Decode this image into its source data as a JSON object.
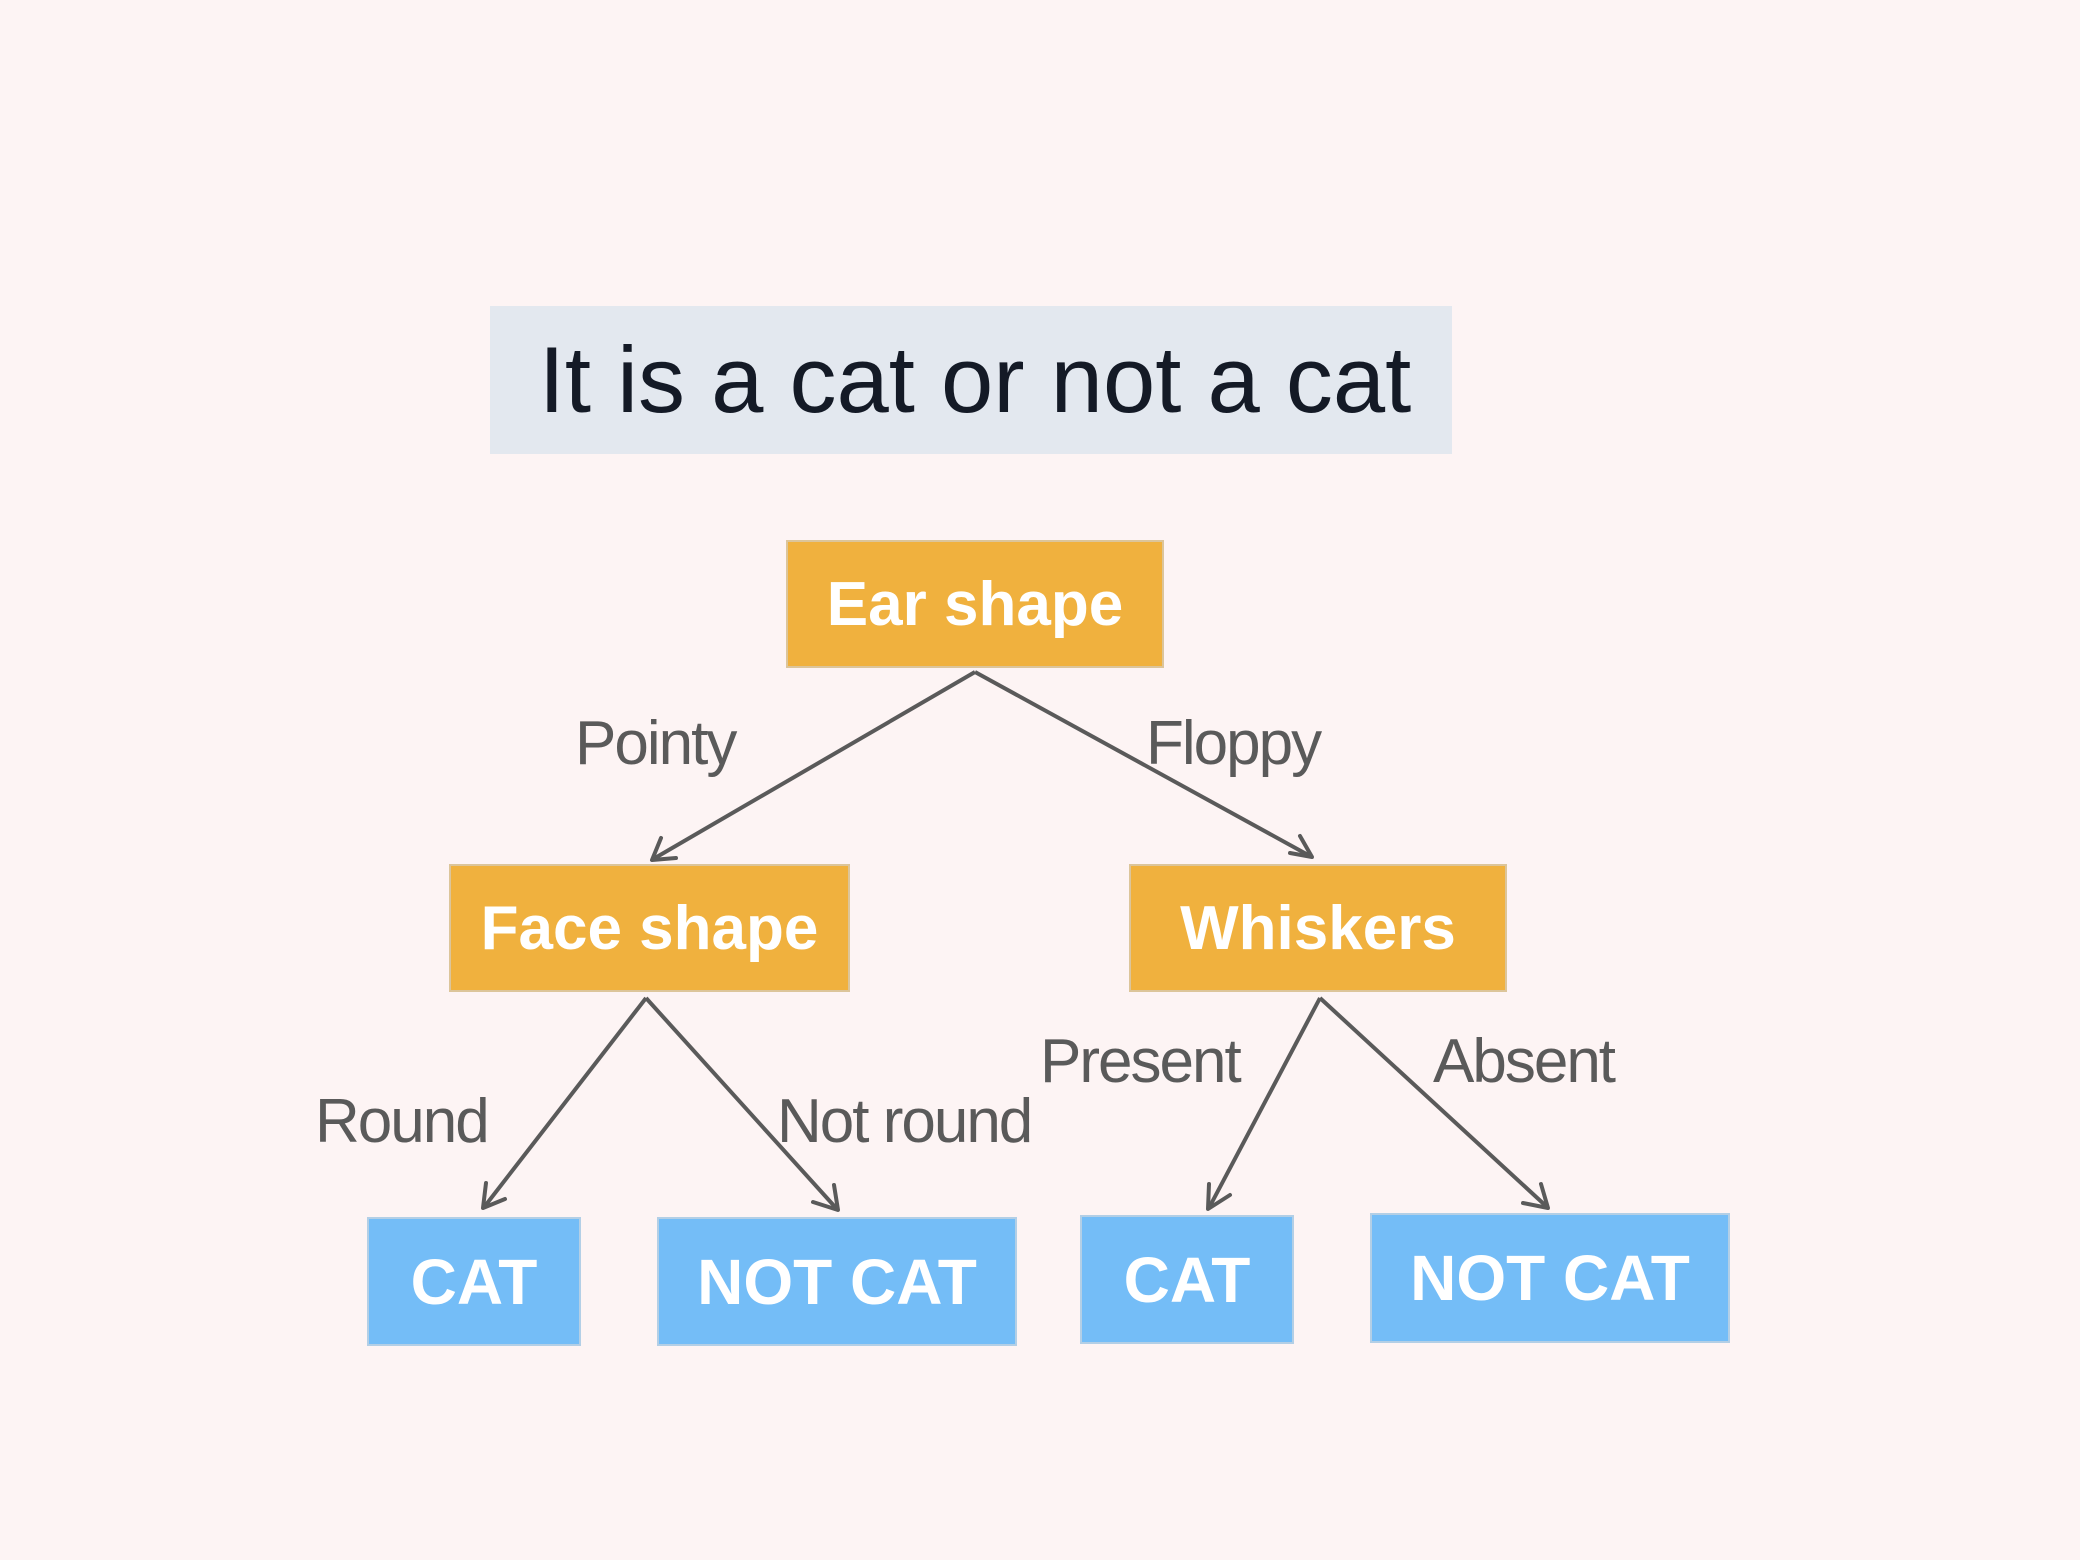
{
  "title": "It is a cat or not a cat",
  "nodes": {
    "root": "Ear shape",
    "left": "Face shape",
    "right": "Whiskers",
    "leaf1": "CAT",
    "leaf2": "NOT CAT",
    "leaf3": "CAT",
    "leaf4": "NOT CAT"
  },
  "edges": {
    "pointy": "Pointy",
    "floppy": "Floppy",
    "round": "Round",
    "not_round": "Not round",
    "present": "Present",
    "absent": "Absent"
  },
  "colors": {
    "decision_node": "#f0b13e",
    "leaf_node": "#74bdf7",
    "title_background": "#e3e8ef",
    "edge": "#5a5a5a",
    "page_background": "#fdf4f4"
  }
}
